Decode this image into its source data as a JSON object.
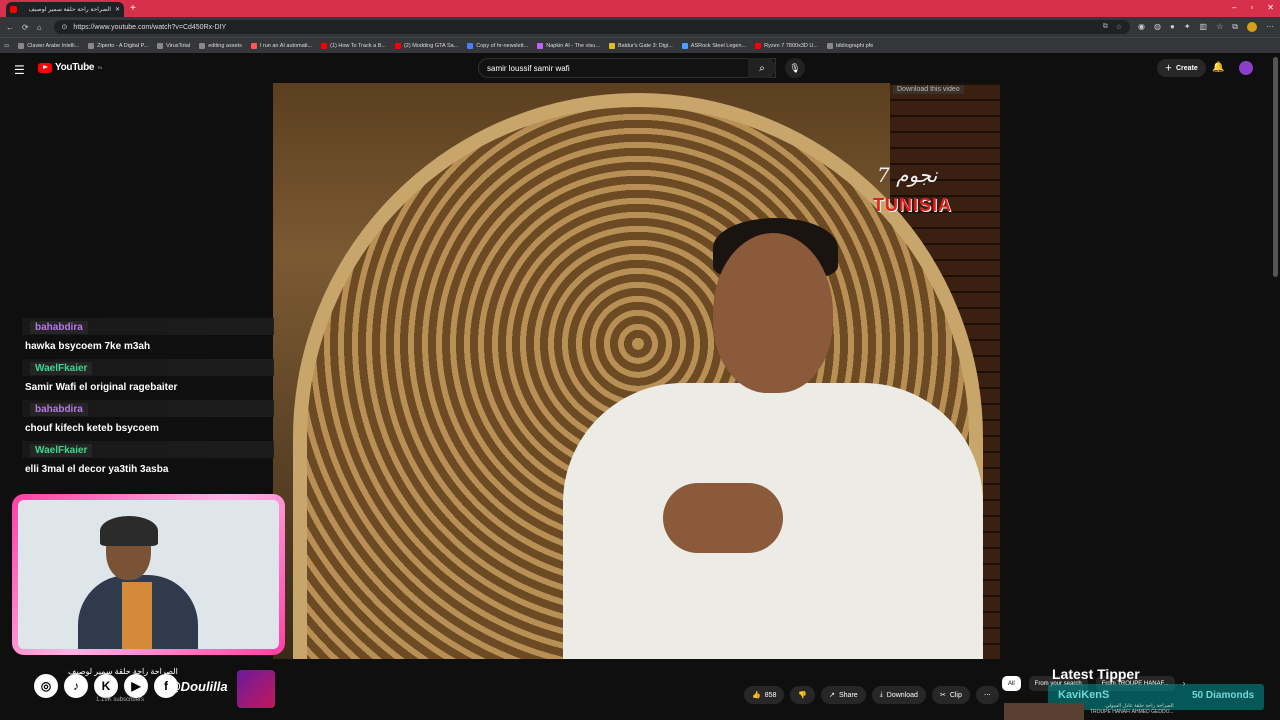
{
  "browser": {
    "tab_title": "الصراحة راحة حلقة سمير لوصيف",
    "new_tab": "+",
    "url": "https://www.youtube.com/watch?v=Cd450Rx-DIY",
    "window_controls": [
      "–",
      "▫",
      "✕"
    ]
  },
  "bookmarks": [
    "Clavier Arabe Intelli...",
    "Ziperto - A Digital P...",
    "VirusTotal",
    "editing assets",
    "I run an AI automati...",
    "(1) How To Track a B...",
    "(2) Modding GTA Sa...",
    "Copy of hr-newslett...",
    "Napkin AI - The visu...",
    "Baldur's Gate 3: Digi...",
    "ASRock Steel Legen...",
    "Ryzen 7 7800x3D U...",
    "bibliographi pfe"
  ],
  "youtube": {
    "logo_text": "YouTube",
    "logo_sup": "TN",
    "search_query": "samir loussif samir wafi",
    "create_label": "Create"
  },
  "video": {
    "download_hint": "Download this video",
    "watermark_top": "7 نجوم",
    "watermark_brand": "TUNISIA"
  },
  "chat": [
    {
      "user": "bahabdira",
      "user_color": "#b877e8",
      "text": "hawka bsycoem 7ke m3ah"
    },
    {
      "user": "WaelFkaier",
      "user_color": "#3ed68d",
      "text": "Samir Wafi el original ragebaiter"
    },
    {
      "user": "bahabdira",
      "user_color": "#b877e8",
      "text": "chouf kifech keteb bsycoem"
    },
    {
      "user": "WaelFkaier",
      "user_color": "#3ed68d",
      "text": "elli 3mal el decor ya3tih 3asba"
    }
  ],
  "below_video": {
    "title": "الصراحة راحة حلقة سمير لوصيف",
    "subscribers": "1.19K subscribers",
    "handle": "@Doulilla",
    "likes": "858",
    "share": "Share",
    "download": "Download",
    "clip": "Clip"
  },
  "chips": [
    "All",
    "From your search",
    "From TROUPE HANAF..."
  ],
  "tipper": {
    "title": "Latest Tipper",
    "name": "KaviKenS",
    "amount": "50 Diamonds"
  },
  "recommendation": {
    "title": "الصراحة راحة حلقة عادل السولي",
    "channel": "TROUPE HANAFI AHMED GEDDO..."
  },
  "colors": {
    "tab_bar": "#d7304c",
    "cam_border": "#ff3ea5",
    "yt_red": "#ff0000"
  }
}
